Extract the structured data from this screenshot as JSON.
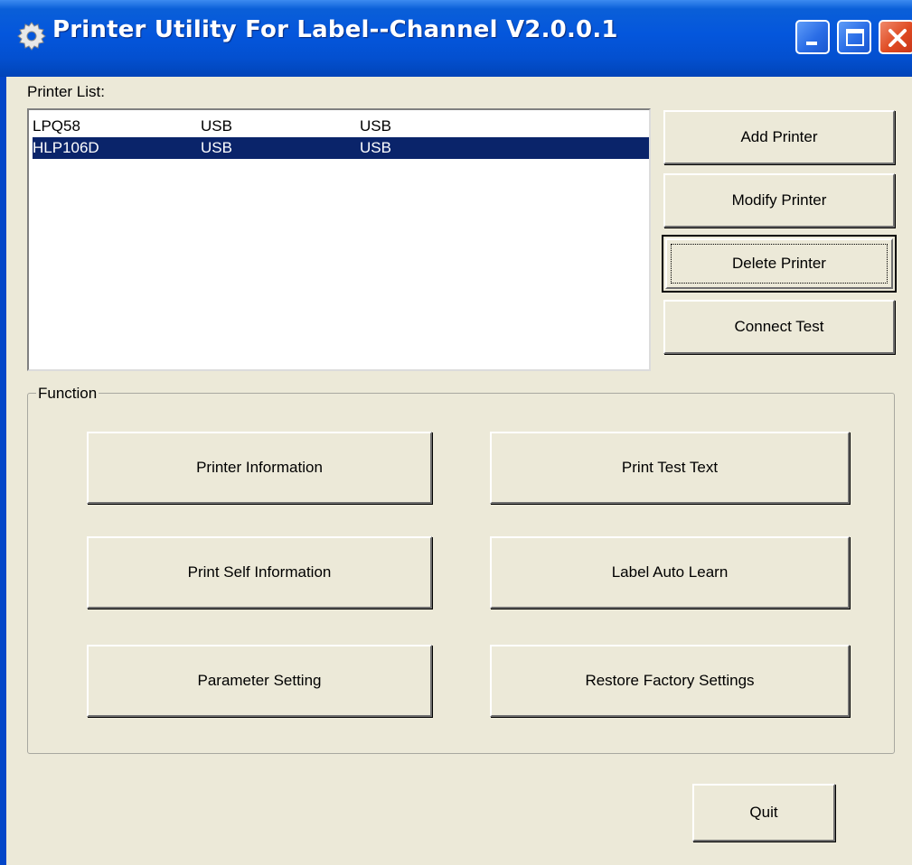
{
  "window": {
    "title": "Printer Utility For Label--Channel  V2.0.0.1",
    "title_color": "#0454dc",
    "background": "#ece9d8"
  },
  "printer_list": {
    "label": "Printer List:",
    "rows": [
      {
        "name": "LPQ58",
        "port": "USB",
        "type": "USB",
        "selected": false
      },
      {
        "name": "HLP106D",
        "port": "USB",
        "type": "USB",
        "selected": true
      }
    ],
    "selection_color": "#0a246a"
  },
  "side_buttons": {
    "add": "Add Printer",
    "modify": "Modify Printer",
    "delete": "Delete Printer",
    "connect": "Connect Test"
  },
  "function_group": {
    "label": "Function",
    "printer_information": "Printer Information",
    "print_test_text": "Print Test Text",
    "print_self_information": "Print Self Information",
    "label_auto_learn": "Label Auto Learn",
    "parameter_setting": "Parameter Setting",
    "restore_factory_settings": "Restore Factory Settings"
  },
  "footer": {
    "quit": "Quit"
  },
  "icons": {
    "app": "gear-icon",
    "minimize": "minimize-icon",
    "maximize": "maximize-icon",
    "close": "close-icon"
  }
}
